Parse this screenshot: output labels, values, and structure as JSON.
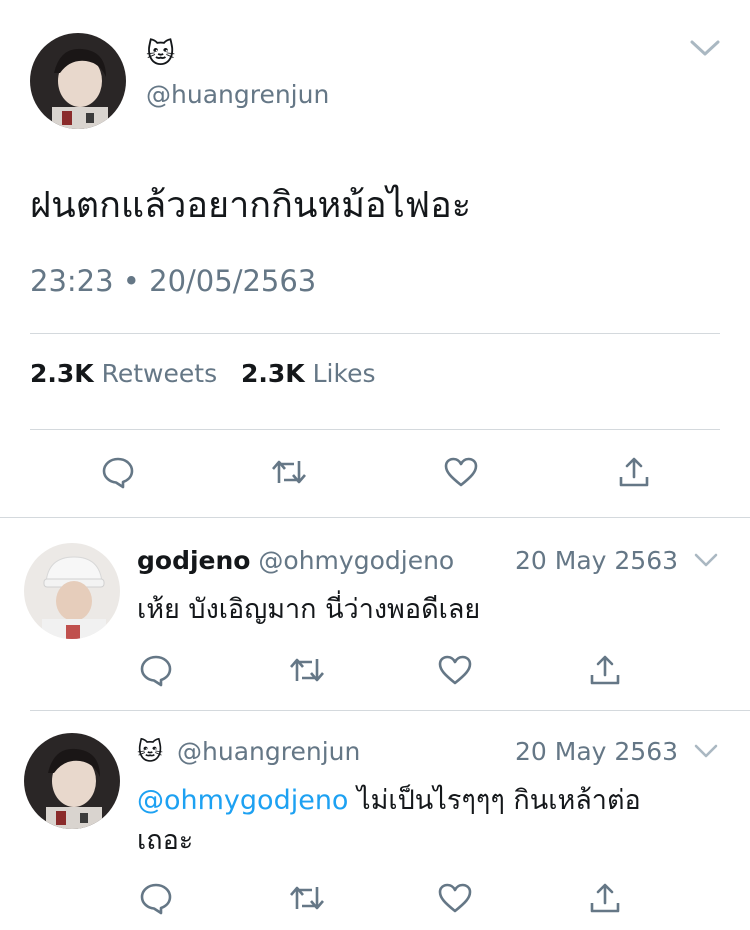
{
  "main_tweet": {
    "emoji": "🐱",
    "handle": "@huangrenjun",
    "text": "ฝนตกแล้วอยากกินหม้อไฟอะ",
    "time": "23:23 • 20/05/2563",
    "retweet_count": "2.3K",
    "retweet_label": "Retweets",
    "like_count": "2.3K",
    "like_label": "Likes"
  },
  "replies": [
    {
      "name": "godjeno",
      "handle": "@ohmygodjeno",
      "date": "20 May 2563",
      "text": "เห้ย บังเอิญมาก นี่ว่างพอดีเลย"
    },
    {
      "emoji": "🐱",
      "handle": "@huangrenjun",
      "date": "20 May 2563",
      "mention": "@ohmygodjeno",
      "text_line1": " ไม่เป็นไรๆๆๆ กินเหล้าต่อ",
      "text_line2": "เถอะ"
    }
  ],
  "icons": {
    "reply": "reply-icon",
    "retweet": "retweet-icon",
    "like": "heart-icon",
    "share": "share-icon",
    "more": "chevron-down-icon"
  },
  "colors": {
    "text": "#14171a",
    "secondary": "#657786",
    "link": "#1da1f2",
    "divider": "#d4d9dd"
  }
}
